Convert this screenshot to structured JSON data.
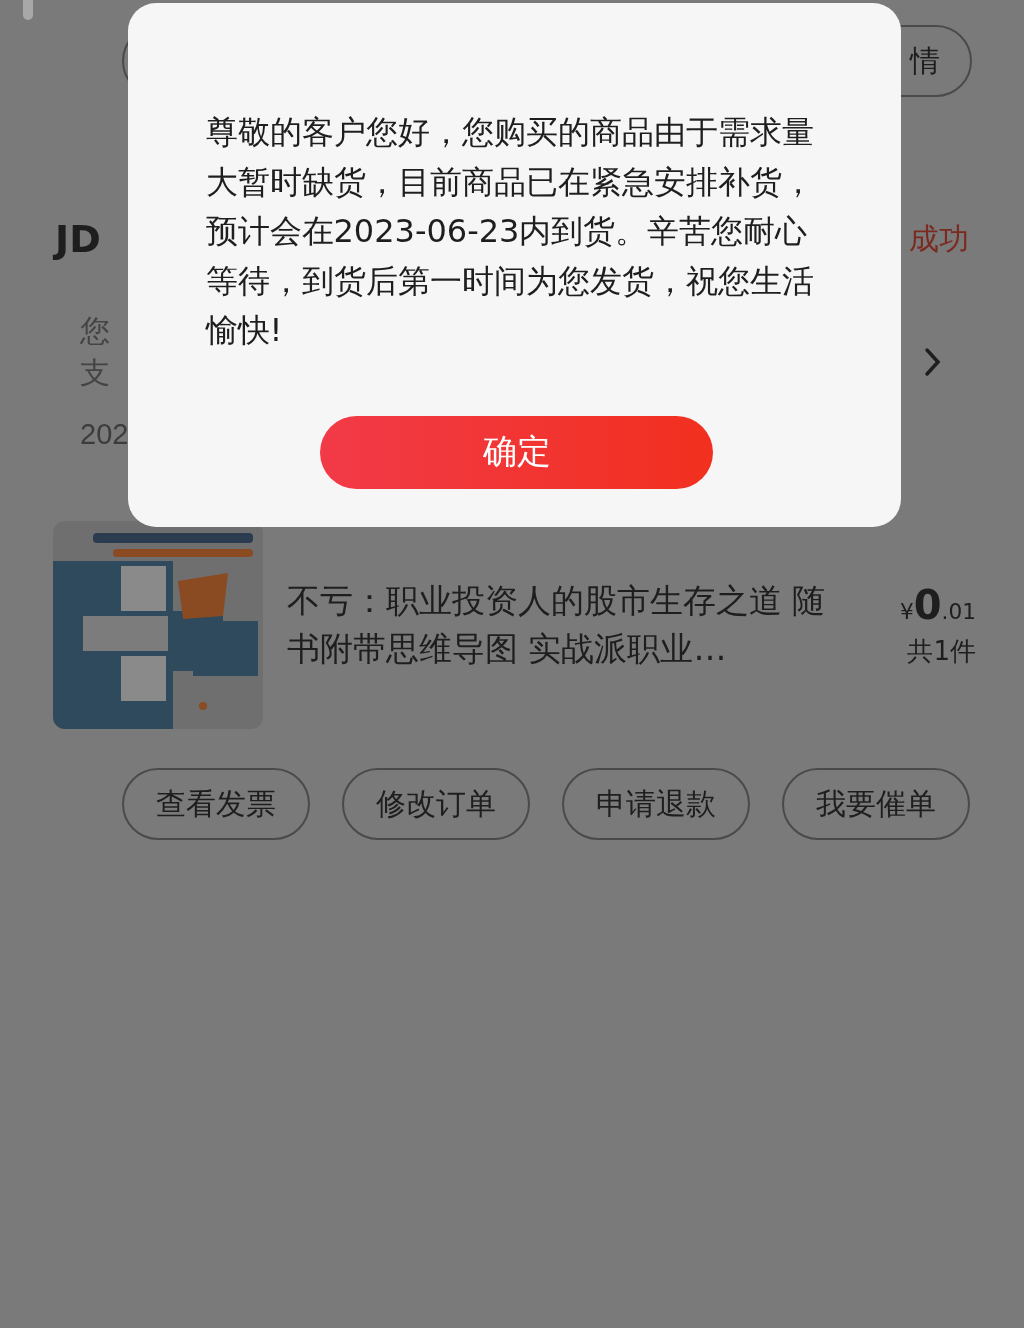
{
  "page": {
    "detail_button": {
      "label": "情"
    },
    "shop": {
      "name": "JD",
      "status": "成功"
    },
    "notice": {
      "lines": [
        "您",
        "支"
      ],
      "date": "202"
    },
    "product": {
      "title": "不亏：职业投资人的股市生存之道 随书附带思维导图 实战派职业…",
      "price_symbol": "¥",
      "price_integer": "0",
      "price_decimal": ".01",
      "count": "共1件"
    },
    "actions": [
      "查看发票",
      "修改订单",
      "申请退款",
      "我要催单"
    ]
  },
  "dialog": {
    "message": "尊敬的客户您好，您购买的商品由于需求量大暂时缺货，目前商品已在紧急安排补货，预计会在2023-06-23内到货。辛苦您耐心等待，到货后第一时间为您发货，祝您生活愉快!",
    "button": "确定"
  }
}
